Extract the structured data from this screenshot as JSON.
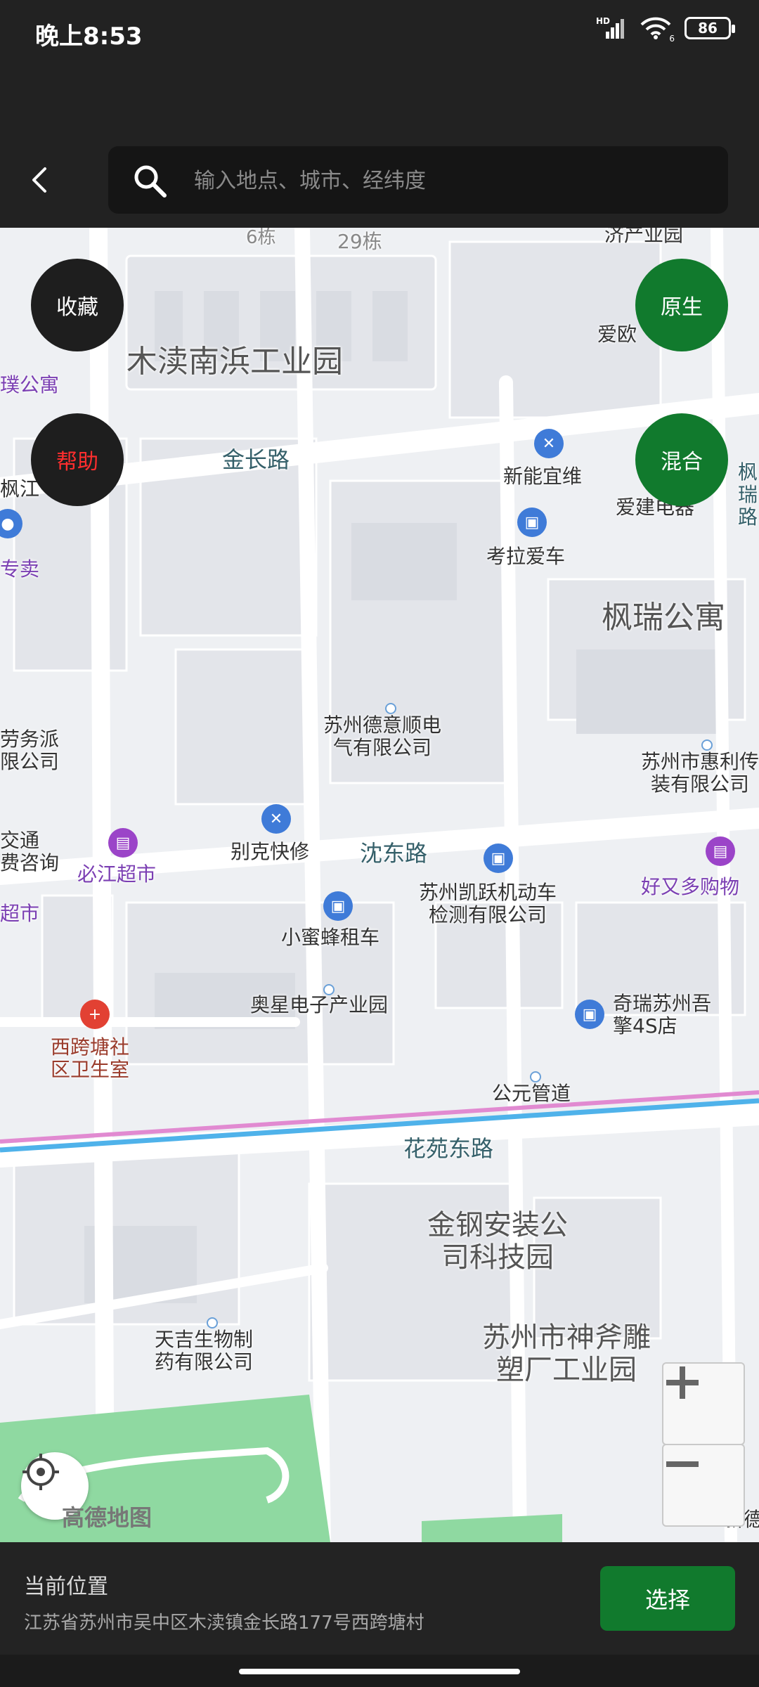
{
  "status_bar": {
    "time": "晚上8:53",
    "signal_label": "HD",
    "battery": "86",
    "wifi_badge": "6"
  },
  "search": {
    "placeholder": "输入地点、城市、经纬度"
  },
  "map_buttons": {
    "favorite": "收藏",
    "help": "帮助",
    "native": "原生",
    "hybrid": "混合"
  },
  "map_labels": {
    "building_29": "29栋",
    "building_6": "6栋",
    "industrial_park": "木渎南浜工业园",
    "economic_park": "济产业园",
    "pu_apartment": "璞公寓",
    "ai_ou": "爱欧",
    "jinchang_road": "金长路",
    "xinneng": "新能宜维",
    "ai_jian": "爱建电器",
    "fengjiang": "枫江",
    "kaola": "考拉爱车",
    "zhuanmai": "专卖",
    "fengrui": "枫瑞公寓",
    "feng_road": "枫瑞路",
    "labor": "劳务派\n限公司",
    "deyi": "苏州德意顺电\n气有限公司",
    "huili": "苏州市惠利传\n装有限公司",
    "traffic": "交通\n费咨询",
    "bijiang": "必江超市",
    "bieke": "别克快修",
    "shendong": "沈东路",
    "kaiyue": "苏州凯跃机动车\n检测有限公司",
    "haoyouduo": "好又多购物",
    "chaoshi": "超市",
    "xiaomifeng": "小蜜蜂租车",
    "aoxing": "奥星电子产业园",
    "chery": "奇瑞苏州吾\n擎4S店",
    "clinic": "西跨塘社\n区卫生室",
    "gongyuan": "公元管道",
    "huayuan": "花苑东路",
    "jingang": "金钢安装公\n司科技园",
    "tianji": "天吉生物制\n药有限公司",
    "shenfu": "苏州市神斧雕\n塑厂工业园",
    "xinde": "新德",
    "amap": "高德地图"
  },
  "current_location": {
    "title": "当前位置",
    "address": "江苏省苏州市吴中区木渎镇金长路177号西跨塘村"
  },
  "select_button": "选择",
  "colors": {
    "accent_green": "#117a2d",
    "help_red": "#ff2e2e"
  }
}
